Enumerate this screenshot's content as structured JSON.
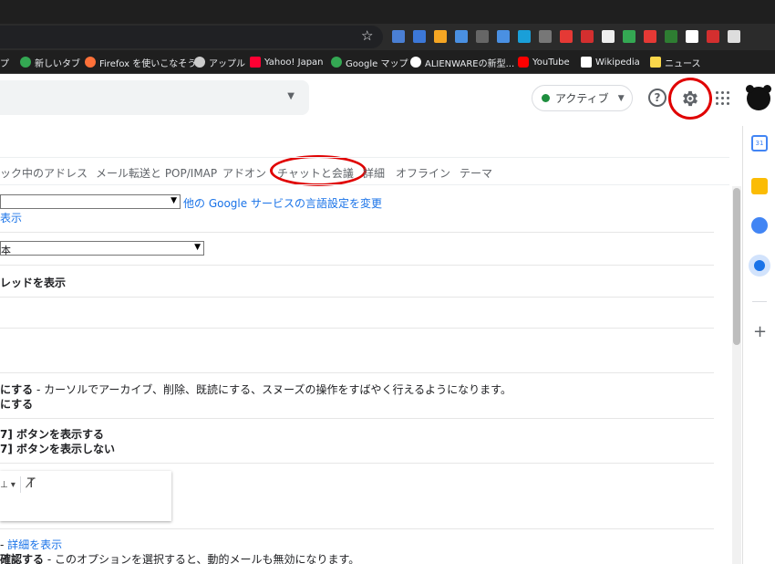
{
  "bookmarks": [
    {
      "label": "プ",
      "color": "#4285f4"
    },
    {
      "label": "新しいタブ",
      "color": "#34a853"
    },
    {
      "label": "Firefox を使いこなそう",
      "color": "#ff7139"
    },
    {
      "label": "アップル",
      "color": "#cccccc"
    },
    {
      "label": "Yahoo! Japan",
      "color": "#ff0033"
    },
    {
      "label": "Google マップ",
      "color": "#34a853"
    },
    {
      "label": "ALIENWAREの新型...",
      "color": "#ffffff"
    },
    {
      "label": "YouTube",
      "color": "#ff0000"
    },
    {
      "label": "Wikipedia",
      "color": "#ffffff"
    },
    {
      "label": "ニュース",
      "color": "#f9d64a"
    }
  ],
  "extensions": [
    "#4a7fd4",
    "#3c78d8",
    "#f5a623",
    "#4a90e2",
    "#666666",
    "#4a90e2",
    "#1a9fd8",
    "#777777",
    "#e53935",
    "#d32f2f",
    "#eeeeee",
    "#34a853",
    "#e53935",
    "#2e7d32",
    "#ffffff",
    "#d32f2f",
    "#dddddd"
  ],
  "header": {
    "status_label": "アクティブ",
    "help_symbol": "?"
  },
  "tabs": [
    "ック中のアドレス",
    "メール転送と POP/IMAP",
    "アドオン",
    "チャットと会議",
    "詳細",
    "オフライン",
    "テーマ"
  ],
  "settings": {
    "language_link": "他の Google サービスの言語設定を変更",
    "show_text": "表示",
    "select2_value": "本",
    "thread_label": "レッドを表示",
    "shortcut_on_bold": "にする",
    "shortcut_on_desc": " - カーソルでアーカイブ、削除、既読にする、スヌーズの操作をすばやく行えるようになります。",
    "shortcut_off_bold": "にする",
    "button_show": "7] ボタンを表示する",
    "button_hide": "7] ボタンを表示しない",
    "detail_prefix": " - ",
    "detail_link": "詳細を表示",
    "confirm_bold": "確認する",
    "confirm_desc": " - このオプションを選択すると、動的メールも無効になります。"
  },
  "colors": {
    "highlight_ring": "#e00000",
    "link": "#1a73e8",
    "status_green": "#1e8e3e"
  }
}
